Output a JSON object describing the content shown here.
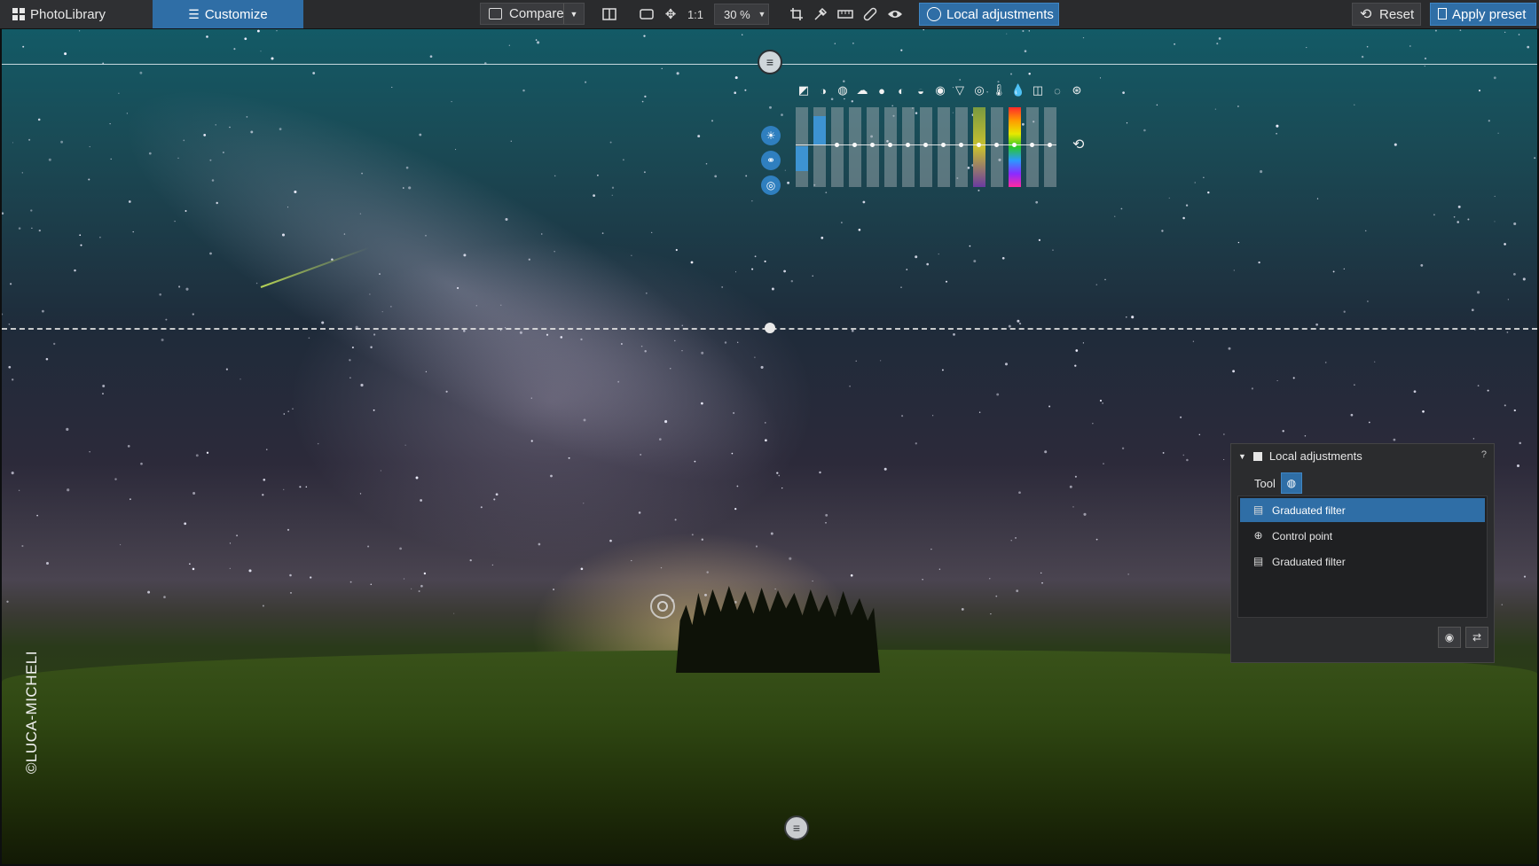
{
  "toolbar": {
    "photolibrary_label": "PhotoLibrary",
    "customize_label": "Customize",
    "compare_label": "Compare",
    "ratio_label": "1:1",
    "zoom_value": "30 %",
    "local_adjustments_label": "Local adjustments",
    "reset_label": "Reset",
    "apply_preset_label": "Apply preset"
  },
  "canvas": {
    "watermark": "©LUCA-MICHELI"
  },
  "local_adjustments_panel": {
    "title": "Local adjustments",
    "help": "?",
    "tool_label": "Tool",
    "items": [
      {
        "label": "Graduated filter",
        "icon": "graduated-filter-icon",
        "selected": true
      },
      {
        "label": "Control point",
        "icon": "control-point-icon",
        "selected": false
      },
      {
        "label": "Graduated filter",
        "icon": "graduated-filter-icon",
        "selected": false
      }
    ]
  },
  "colors": {
    "accent": "#2f6ea6",
    "toolbar_bg": "#2a2b2d",
    "panel_bg": "#2b2c2e"
  }
}
